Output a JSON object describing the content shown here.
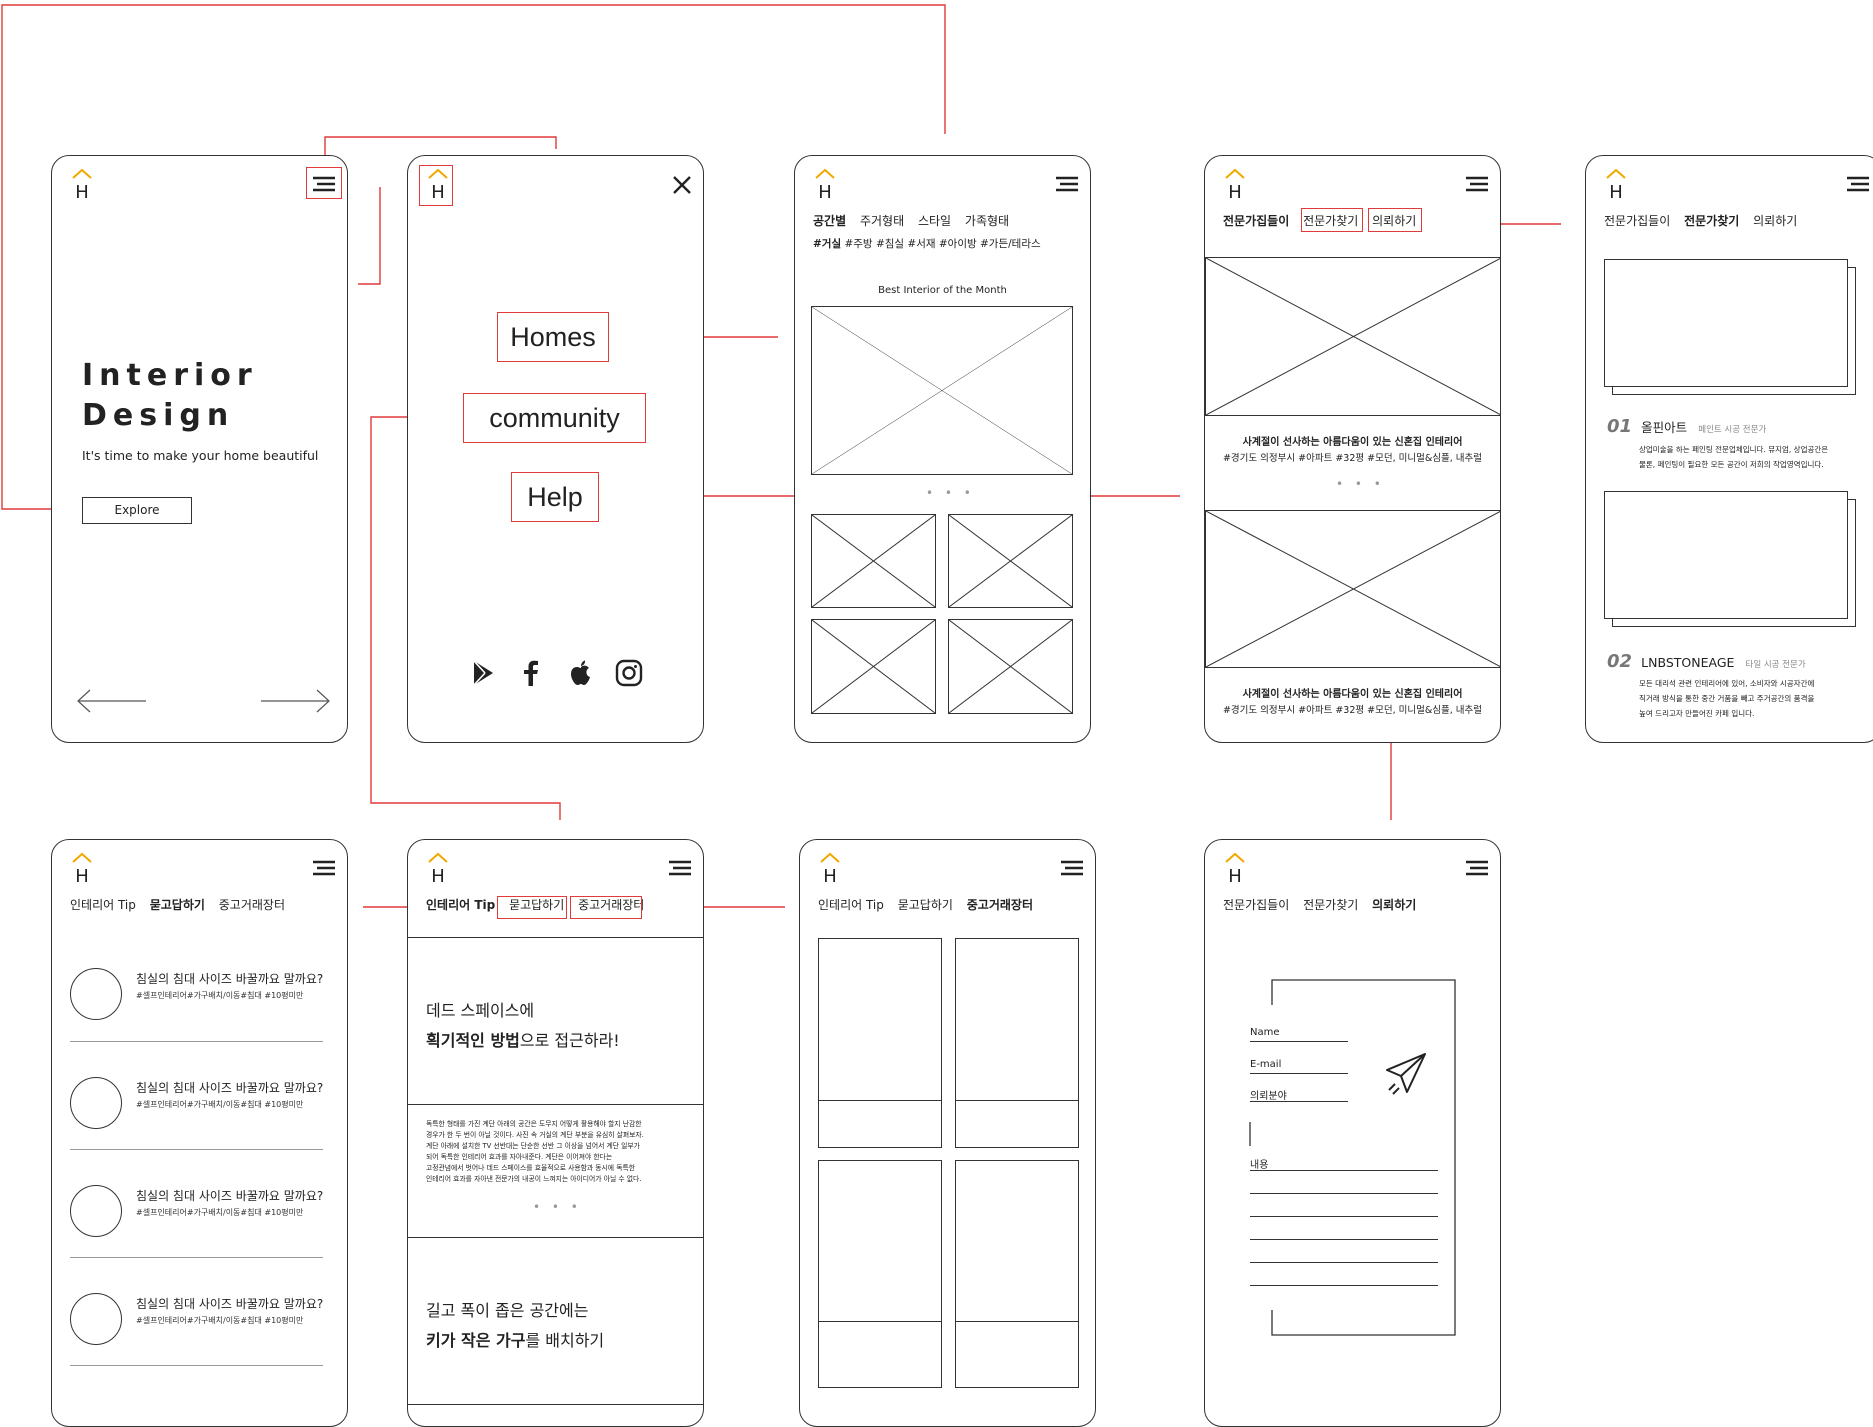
{
  "logo": {
    "letter": "H",
    "roof_color": "#f0a800"
  },
  "screen_home": {
    "title_line1": "Interior",
    "title_line2": "Design",
    "subtitle": "It's time to make your home beautiful",
    "explore_button": "Explore"
  },
  "screen_menu": {
    "items": [
      "Homes",
      "community",
      "Help"
    ],
    "close_icon": "close-icon",
    "social_icons": [
      "google-play-icon",
      "facebook-icon",
      "apple-icon",
      "instagram-icon"
    ]
  },
  "screen_homes": {
    "nav": [
      "공간별",
      "주거형태",
      "스타일",
      "가족형태"
    ],
    "tags": [
      "#거실",
      "#주방",
      "#침실",
      "#서재",
      "#아이방",
      "#가든/테라스"
    ],
    "best_label": "Best Interior of the Month"
  },
  "screen_experts": {
    "nav": [
      "전문가집들이",
      "전문가찾기",
      "의뢰하기"
    ],
    "post_title": "사계절이 선사하는 아름다움이 있는 신혼집 인테리어",
    "post_tags": "#경기도 의정부시 #아파트 #32평 #모던, 미니멀&심플, 내추럴"
  },
  "screen_find_expert": {
    "nav": [
      "전문가집들이",
      "전문가찾기",
      "의뢰하기"
    ],
    "experts": [
      {
        "num": "01",
        "name": "올핀아트",
        "kind": "페인트 시공 전문가",
        "desc1": "상업미술을 하는 페인팅 전문업체입니다. 뮤지엄, 상업공간은",
        "desc2": "물론, 페인팅이 필요한 모든 공간이 저희의 작업영역입니다."
      },
      {
        "num": "02",
        "name": "LNBSTONEAGE",
        "kind": "타일 시공 전문가",
        "desc1": "모든 대리석 관련 인테리어에 있어, 소비자와 시공자간에",
        "desc2": "직거래 방식을 통한 중간 거품을 빼고 주거공간의 품격을",
        "desc3": "높여 드리고자 만들어진 카페 입니다."
      }
    ]
  },
  "screen_qa": {
    "nav": [
      "인테리어 Tip",
      "묻고답하기",
      "중고거래장터"
    ],
    "question": "침실의 침대 사이즈 바꿀까요 말까요?",
    "tags": "#셀프인테리어#가구배치/이동#침대 #10평미만"
  },
  "screen_tips": {
    "nav": [
      "인테리어 Tip",
      "묻고답하기",
      "중고거래장터"
    ],
    "tip1_line1": "데드 스페이스에",
    "tip1_bold": "획기적인 방법",
    "tip1_rest": "으로 접근하라!",
    "body": [
      "독특한 형태를 가진 계단 아래의 공간은 도무지 어떻게 활용해야 할지 난감한",
      "경우가 한 두 번이 아닐 것이다. 사진 속 거실의 계단 부분을 유심히 살펴보자.",
      "계단 아래에 설치한 TV 선반대는 단순한 선반 그 이상을 넘어서 계단 일부가",
      "되어 독특한 인테리어 효과를 자아내준다. 계단은 이어져야 한다는",
      "고정관념에서 벗어나 데드 스페이스를 효율적으로 사용함과 동시에 독특한",
      "인테리어 효과를 자아낸 전문가의 내공이 느껴지는 아이디어가 아닐 수 없다."
    ],
    "tip2_line1": "길고 폭이 좁은 공간에는",
    "tip2_bold": "키가 작은 가구",
    "tip2_rest": "를 배치하기"
  },
  "screen_market": {
    "nav": [
      "인테리어 Tip",
      "묻고답하기",
      "중고거래장터"
    ]
  },
  "screen_request": {
    "nav": [
      "전문가집들이",
      "전문가찾기",
      "의뢰하기"
    ],
    "fields": [
      "Name",
      "E-mail",
      "의뢰분야",
      "내용"
    ],
    "send_icon": "paper-plane-icon"
  },
  "colors": {
    "accent_red": "#e03a3a",
    "stroke": "#333333"
  }
}
